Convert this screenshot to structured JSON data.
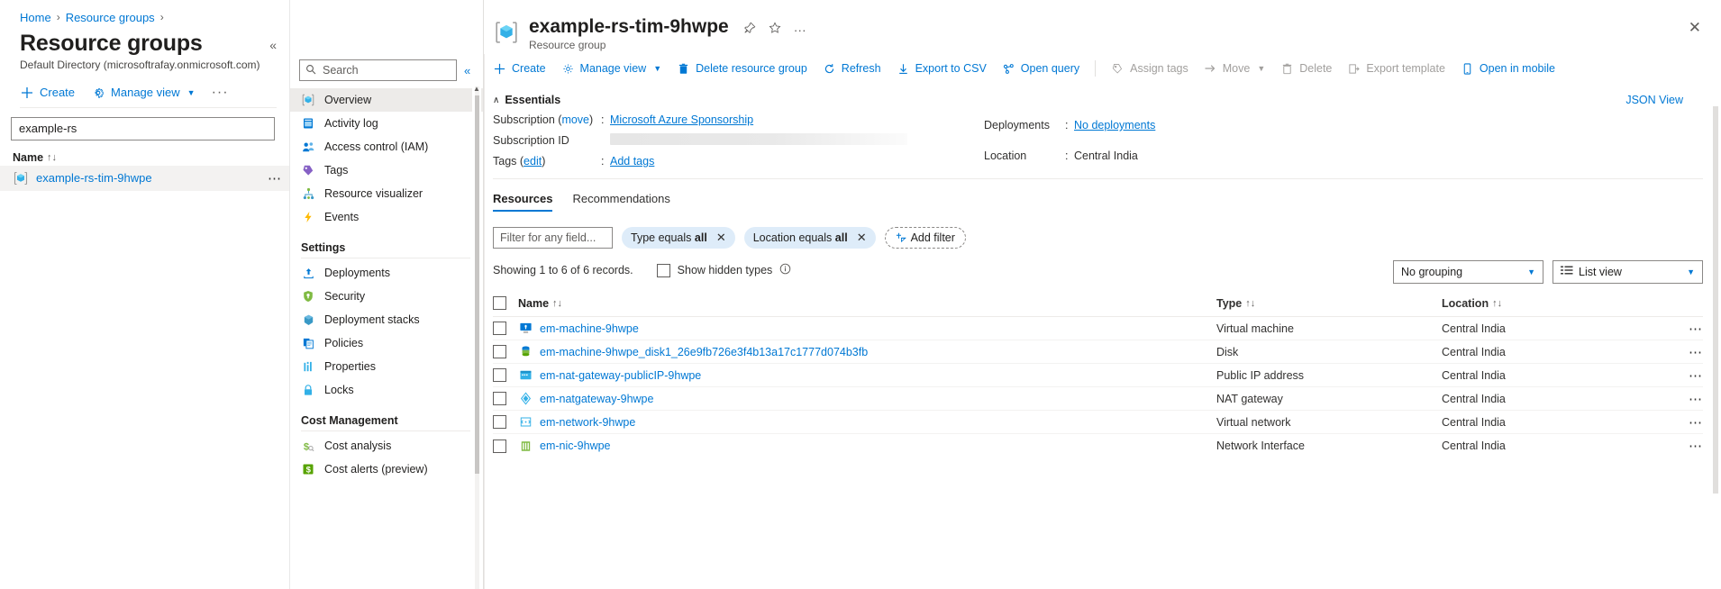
{
  "breadcrumb": {
    "home": "Home",
    "sep": "›",
    "resource_groups": "Resource groups"
  },
  "left_pane": {
    "title": "Resource groups",
    "subtitle": "Default Directory (microsoftrafay.onmicrosoft.com)",
    "collapse_icon": "chevron-double-left-icon",
    "commands": [
      {
        "label": "Create",
        "icon": "plus-icon"
      },
      {
        "label": "Manage view",
        "icon": "gear-icon",
        "has_chevron": true
      },
      {
        "label": "…",
        "icon": "more-icon"
      }
    ],
    "filter_value": "example-rs",
    "filter_placeholder": "Filter for any field...",
    "column_header": "Name",
    "sort_glyph": "↑↓",
    "rows": [
      {
        "name": "example-rs-tim-9hwpe",
        "icon": "resource-group-icon",
        "menu": "⋯"
      }
    ]
  },
  "nav": {
    "search_placeholder": "Search",
    "collapse_icon": "chevron-double-left-icon",
    "items": [
      {
        "label": "Overview",
        "icon": "resource-group-icon",
        "selected": true
      },
      {
        "label": "Activity log",
        "icon": "activity-log-icon",
        "selected": false
      },
      {
        "label": "Access control (IAM)",
        "icon": "access-control-icon",
        "selected": false
      },
      {
        "label": "Tags",
        "icon": "tag-icon",
        "selected": false
      },
      {
        "label": "Resource visualizer",
        "icon": "resource-visualizer-icon",
        "selected": false
      },
      {
        "label": "Events",
        "icon": "events-lightning-icon",
        "selected": false
      }
    ],
    "groups": [
      {
        "title": "Settings",
        "items": [
          {
            "label": "Deployments",
            "icon": "deployments-icon"
          },
          {
            "label": "Security",
            "icon": "shield-icon"
          },
          {
            "label": "Deployment stacks",
            "icon": "deployment-stacks-icon"
          },
          {
            "label": "Policies",
            "icon": "policies-icon"
          },
          {
            "label": "Properties",
            "icon": "properties-icon"
          },
          {
            "label": "Locks",
            "icon": "lock-icon"
          }
        ]
      },
      {
        "title": "Cost Management",
        "items": [
          {
            "label": "Cost analysis",
            "icon": "cost-analysis-icon"
          },
          {
            "label": "Cost alerts (preview)",
            "icon": "cost-alerts-icon"
          }
        ]
      }
    ]
  },
  "main": {
    "title": "example-rs-tim-9hwpe",
    "subtitle": "Resource group",
    "icon": "resource-group-icon",
    "title_actions": [
      {
        "label": "Pin",
        "icon": "pin-icon"
      },
      {
        "label": "Favorite",
        "icon": "star-icon"
      },
      {
        "label": "More",
        "icon": "more-ellipsis-icon"
      }
    ],
    "close_label": "✕",
    "toolbar": [
      {
        "label": "Create",
        "icon": "plus-icon",
        "disabled": false
      },
      {
        "label": "Manage view",
        "icon": "gear-icon",
        "disabled": false,
        "has_chevron": true
      },
      {
        "label": "Delete resource group",
        "icon": "trash-icon",
        "disabled": false
      },
      {
        "label": "Refresh",
        "icon": "refresh-icon",
        "disabled": false
      },
      {
        "label": "Export to CSV",
        "icon": "download-arrow-icon",
        "disabled": false
      },
      {
        "label": "Open query",
        "icon": "open-query-icon",
        "disabled": false
      },
      {
        "separator": true
      },
      {
        "label": "Assign tags",
        "icon": "tag-icon",
        "disabled": true
      },
      {
        "label": "Move",
        "icon": "arrow-right-icon",
        "disabled": true,
        "has_chevron": true
      },
      {
        "label": "Delete",
        "icon": "trash-icon",
        "disabled": true
      },
      {
        "label": "Export template",
        "icon": "export-template-icon",
        "disabled": true
      },
      {
        "label": "Open in mobile",
        "icon": "mobile-icon",
        "disabled": false
      }
    ],
    "essentials": {
      "header": "Essentials",
      "caret": "∧",
      "json_view": "JSON View",
      "left": [
        {
          "label": "Subscription",
          "sub_link": "move",
          "colon": ":",
          "value": "Microsoft Azure Sponsorship",
          "is_link": true
        },
        {
          "label": "Subscription ID",
          "colon": "",
          "value": "",
          "redacted": true
        },
        {
          "label": "Tags",
          "sub_link": "edit",
          "colon": ":",
          "value": "Add tags",
          "is_link": true
        }
      ],
      "right": [
        {
          "label": "Deployments",
          "colon": ":",
          "value": "No deployments",
          "is_link": true
        },
        {
          "label": "Location",
          "colon": ":",
          "value": "Central India",
          "is_link": false
        }
      ]
    },
    "tabs": [
      {
        "label": "Resources",
        "active": true
      },
      {
        "label": "Recommendations",
        "active": false
      }
    ],
    "filters": {
      "text_placeholder": "Filter for any field...",
      "pills": [
        {
          "prefix": "Type equals",
          "value": "all",
          "close": "✕"
        },
        {
          "prefix": "Location equals",
          "value": "all",
          "close": "✕"
        }
      ],
      "add_filter": "Add filter",
      "add_filter_icon": "plus-filter-icon"
    },
    "records_text": "Showing 1 to 6 of 6 records.",
    "show_hidden_types": "Show hidden types",
    "info_icon": "info-icon",
    "grouping_dropdown": "No grouping",
    "view_dropdown": "List view",
    "view_dropdown_icon": "list-view-icon",
    "table": {
      "columns": [
        {
          "label": "Name",
          "sort": "↑↓"
        },
        {
          "label": "Type",
          "sort": "↑↓"
        },
        {
          "label": "Location",
          "sort": "↑↓"
        }
      ],
      "rows": [
        {
          "name": "em-machine-9hwpe",
          "type": "Virtual machine",
          "location": "Central India",
          "icon": "virtual-machine-icon",
          "menu": "⋯"
        },
        {
          "name": "em-machine-9hwpe_disk1_26e9fb726e3f4b13a17c1777d074b3fb",
          "type": "Disk",
          "location": "Central India",
          "icon": "disk-icon",
          "menu": "⋯"
        },
        {
          "name": "em-nat-gateway-publicIP-9hwpe",
          "type": "Public IP address",
          "location": "Central India",
          "icon": "public-ip-icon",
          "menu": "⋯"
        },
        {
          "name": "em-natgateway-9hwpe",
          "type": "NAT gateway",
          "location": "Central India",
          "icon": "nat-gateway-icon",
          "menu": "⋯"
        },
        {
          "name": "em-network-9hwpe",
          "type": "Virtual network",
          "location": "Central India",
          "icon": "virtual-network-icon",
          "menu": "⋯"
        },
        {
          "name": "em-nic-9hwpe",
          "type": "Network Interface",
          "location": "Central India",
          "icon": "network-interface-icon",
          "menu": "⋯"
        }
      ]
    }
  }
}
